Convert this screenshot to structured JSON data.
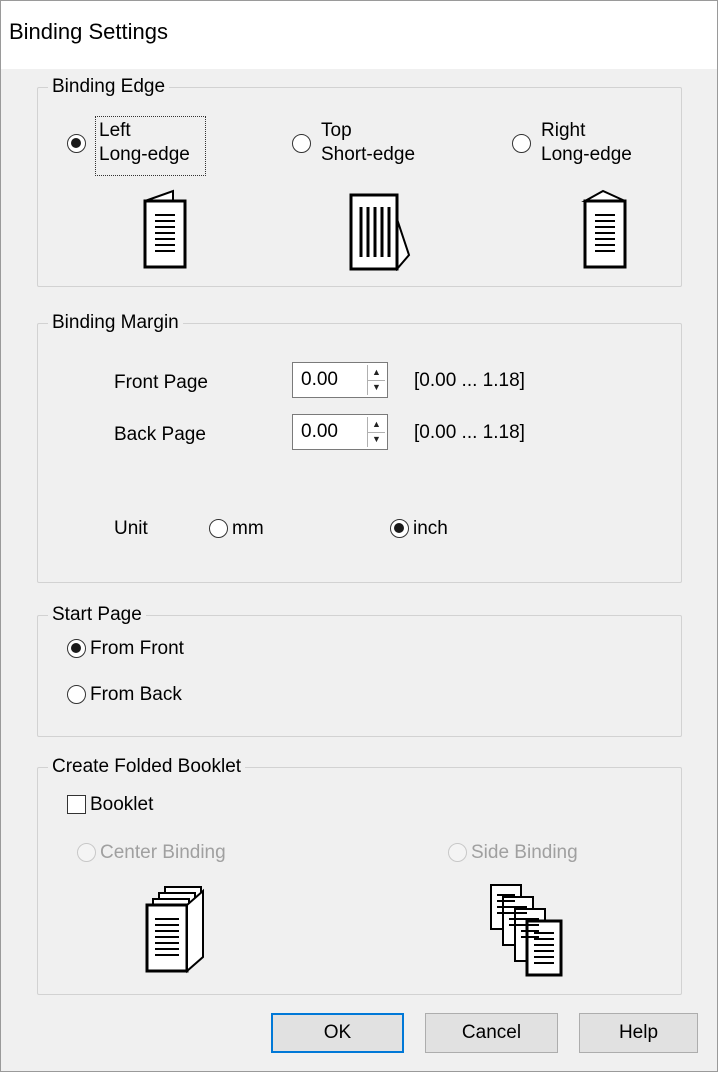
{
  "window": {
    "title": "Binding Settings"
  },
  "binding_edge": {
    "legend": "Binding Edge",
    "options": [
      {
        "line1": "Left",
        "line2": "Long-edge",
        "selected": true,
        "icon": "left-binding-icon"
      },
      {
        "line1": "Top",
        "line2": "Short-edge",
        "selected": false,
        "icon": "top-binding-icon"
      },
      {
        "line1": "Right",
        "line2": "Long-edge",
        "selected": false,
        "icon": "right-binding-icon"
      }
    ]
  },
  "binding_margin": {
    "legend": "Binding Margin",
    "front_label": "Front Page",
    "front_value": "0.00",
    "front_range": "[0.00 ... 1.18]",
    "back_label": "Back Page",
    "back_value": "0.00",
    "back_range": "[0.00 ... 1.18]",
    "unit_label": "Unit",
    "unit_options": [
      {
        "label": "mm",
        "selected": false
      },
      {
        "label": "inch",
        "selected": true
      }
    ]
  },
  "start_page": {
    "legend": "Start Page",
    "options": [
      {
        "label": "From Front",
        "selected": true
      },
      {
        "label": "From Back",
        "selected": false
      }
    ]
  },
  "folded_booklet": {
    "legend": "Create Folded Booklet",
    "booklet_label": "Booklet",
    "booklet_checked": false,
    "center_binding_label": "Center Binding",
    "side_binding_label": "Side Binding",
    "center_icon": "center-binding-icon",
    "side_icon": "side-binding-icon"
  },
  "buttons": {
    "ok": "OK",
    "cancel": "Cancel",
    "help": "Help"
  },
  "colors": {
    "accent": "#0078d7",
    "dialog_bg": "#f0f0f0",
    "disabled_text": "#a0a0a0"
  }
}
